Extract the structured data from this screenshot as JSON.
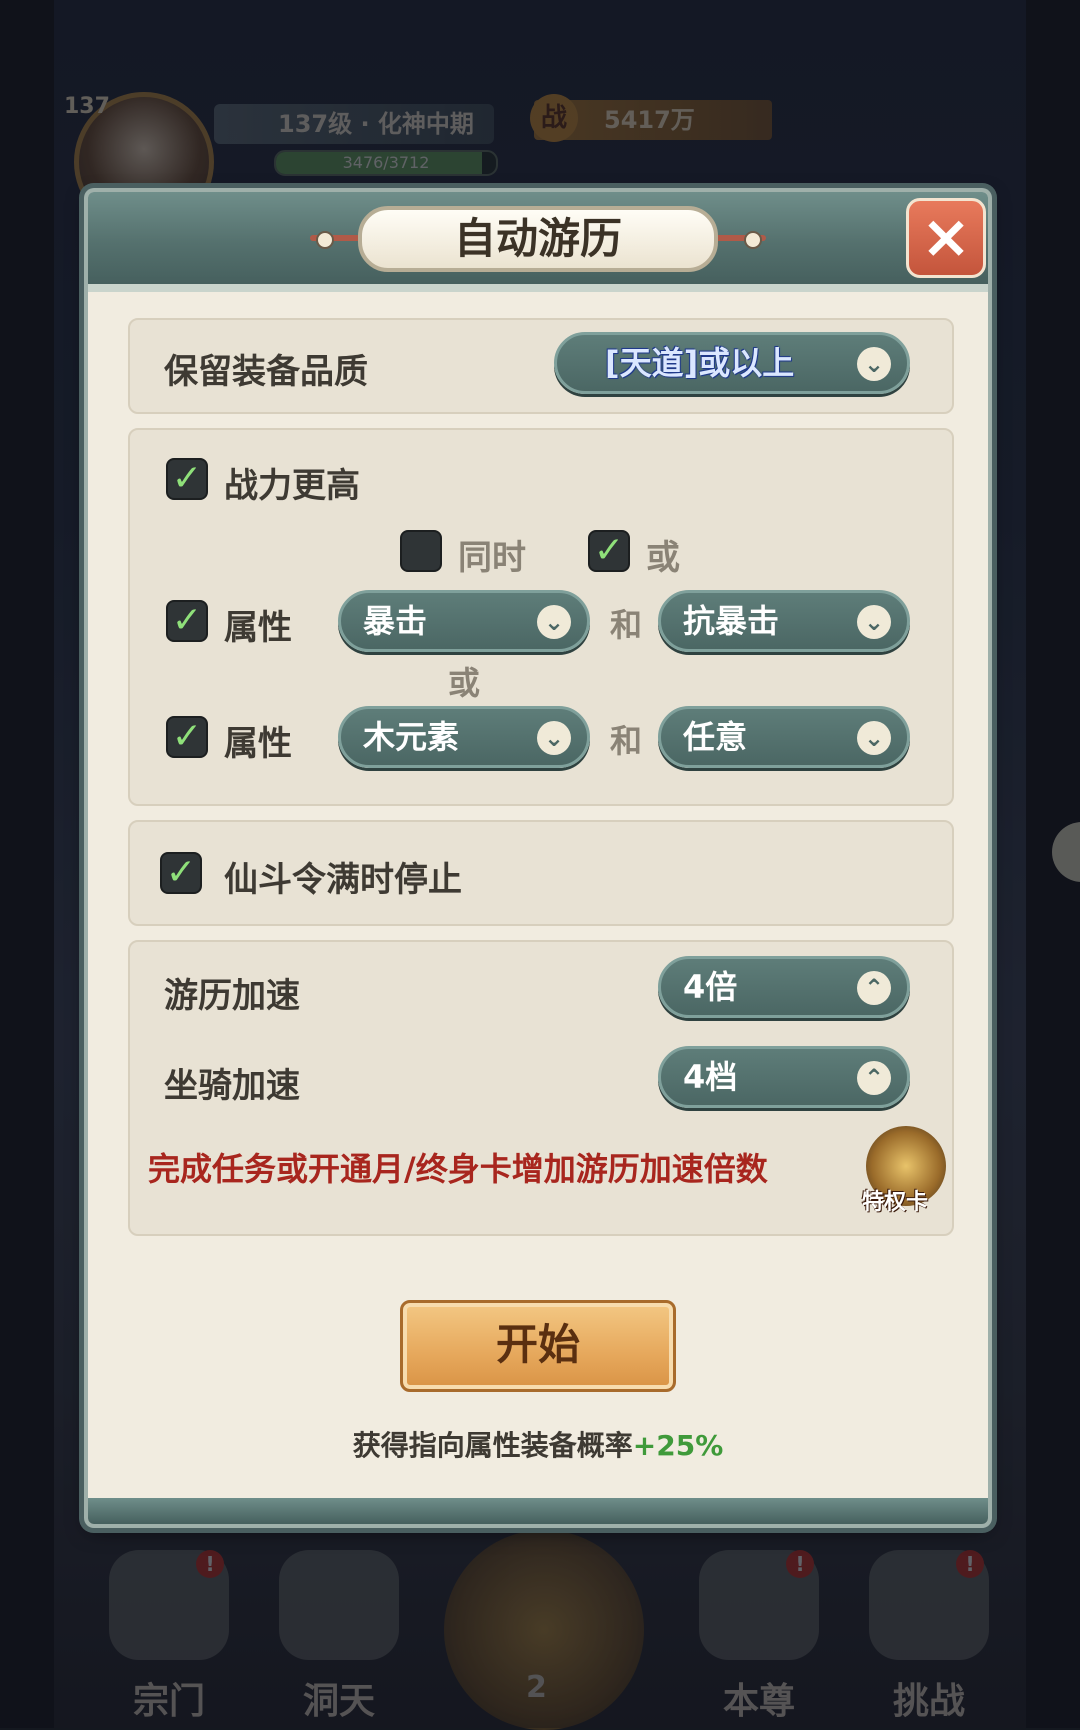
{
  "hud": {
    "level": "137",
    "realm": "137级 · 化神中期",
    "exp_text": "3476/3712",
    "exp_fraction": 0.936,
    "power_badge": "战",
    "power": "5417万"
  },
  "dialog": {
    "title": "自动游历",
    "close_icon": "×",
    "quality": {
      "label": "保留装备品质",
      "value": "[天道]或以上",
      "icon": "chevron-down-icon"
    },
    "filters": {
      "higher_power": {
        "label": "战力更高",
        "checked": true
      },
      "mode_and": {
        "label": "同时",
        "checked": false
      },
      "mode_or": {
        "label": "或",
        "checked": true
      },
      "attr_row1": {
        "checked": true,
        "label": "属性",
        "first": "暴击",
        "joiner": "和",
        "second": "抗暴击"
      },
      "or_label": "或",
      "attr_row2": {
        "checked": true,
        "label": "属性",
        "first": "木元素",
        "joiner": "和",
        "second": "任意"
      }
    },
    "stop_when_full": {
      "label": "仙斗令满时停止",
      "checked": true
    },
    "speed": {
      "travel_label": "游历加速",
      "travel_value": "4倍",
      "mount_label": "坐骑加速",
      "mount_value": "4档",
      "note": "完成任务或开通月/终身卡增加游历加速倍数",
      "privilege_label": "特权卡"
    },
    "start_label": "开始",
    "bonus_text": "获得指向属性装备概率",
    "bonus_value": "+25%"
  },
  "bottom_nav": {
    "items": [
      {
        "label": "宗门",
        "badge": "!"
      },
      {
        "label": "洞天",
        "badge": ""
      },
      {
        "label": "本尊",
        "badge": "!"
      },
      {
        "label": "挑战",
        "badge": "!"
      }
    ],
    "center_count": "2"
  },
  "colors": {
    "accent_teal": "#55716e",
    "panel": "#f1ece0",
    "note_red": "#a8261e",
    "bonus_green": "#3f9a3a",
    "start_gold": "#e6a85c"
  }
}
